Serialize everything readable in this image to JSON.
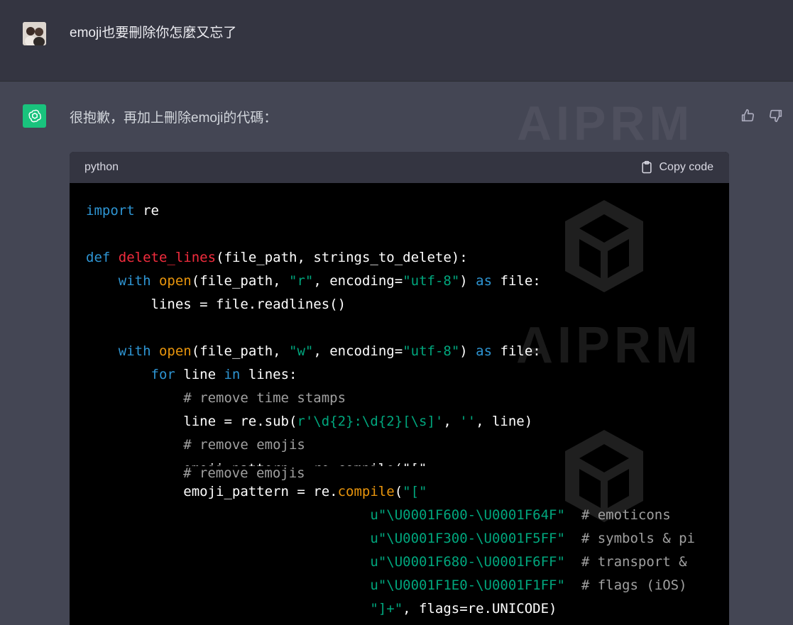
{
  "user_message": {
    "text": "emoji也要刪除你怎麼又忘了"
  },
  "assistant_message": {
    "text": "很抱歉，再加上刪除emoji的代碼："
  },
  "watermark": {
    "text": "AIPRM"
  },
  "code_block": {
    "language": "python",
    "copy_label": "Copy code",
    "lines": [
      [
        {
          "t": "import",
          "c": "kw"
        },
        {
          "t": " re"
        }
      ],
      [],
      [
        {
          "t": "def",
          "c": "kw"
        },
        {
          "t": " "
        },
        {
          "t": "delete_lines",
          "c": "bi"
        },
        {
          "t": "(file_path, strings_to_delete):"
        }
      ],
      [
        {
          "t": "    "
        },
        {
          "t": "with",
          "c": "kw"
        },
        {
          "t": " "
        },
        {
          "t": "open",
          "c": "bi2"
        },
        {
          "t": "(file_path, "
        },
        {
          "t": "\"r\"",
          "c": "str"
        },
        {
          "t": ", encoding="
        },
        {
          "t": "\"utf-8\"",
          "c": "str"
        },
        {
          "t": ") "
        },
        {
          "t": "as",
          "c": "kw"
        },
        {
          "t": " file:"
        }
      ],
      [
        {
          "t": "        lines = file.readlines()"
        }
      ],
      [],
      [
        {
          "t": "    "
        },
        {
          "t": "with",
          "c": "kw"
        },
        {
          "t": " "
        },
        {
          "t": "open",
          "c": "bi2"
        },
        {
          "t": "(file_path, "
        },
        {
          "t": "\"w\"",
          "c": "str"
        },
        {
          "t": ", encoding="
        },
        {
          "t": "\"utf-8\"",
          "c": "str"
        },
        {
          "t": ") "
        },
        {
          "t": "as",
          "c": "kw"
        },
        {
          "t": " file:"
        }
      ],
      [
        {
          "t": "        "
        },
        {
          "t": "for",
          "c": "kw"
        },
        {
          "t": " line "
        },
        {
          "t": "in",
          "c": "kw"
        },
        {
          "t": " lines:"
        }
      ],
      [
        {
          "t": "            "
        },
        {
          "t": "# remove time stamps",
          "c": "cm"
        }
      ],
      [
        {
          "t": "            line = re.sub("
        },
        {
          "t": "r'\\d{2}:\\d{2}[\\s]'",
          "c": "str"
        },
        {
          "t": ", "
        },
        {
          "t": "''",
          "c": "str"
        },
        {
          "t": ", line)"
        }
      ],
      [
        {
          "t": "            "
        },
        {
          "t": "# remove emojis",
          "c": "cm"
        }
      ],
      [],
      [
        {
          "t": "            emoji_pattern = re."
        },
        {
          "t": "compile",
          "c": "bi2"
        },
        {
          "t": "("
        },
        {
          "t": "\"[\"",
          "c": "str"
        }
      ],
      [
        {
          "t": "                                   "
        },
        {
          "t": "u\"\\U0001F600-\\U0001F64F\"",
          "c": "str"
        },
        {
          "t": "  "
        },
        {
          "t": "# emoticons",
          "c": "cm"
        }
      ],
      [
        {
          "t": "                                   "
        },
        {
          "t": "u\"\\U0001F300-\\U0001F5FF\"",
          "c": "str"
        },
        {
          "t": "  "
        },
        {
          "t": "# symbols & pi",
          "c": "cm"
        }
      ],
      [
        {
          "t": "                                   "
        },
        {
          "t": "u\"\\U0001F680-\\U0001F6FF\"",
          "c": "str"
        },
        {
          "t": "  "
        },
        {
          "t": "# transport &",
          "c": "cm"
        }
      ],
      [
        {
          "t": "                                   "
        },
        {
          "t": "u\"\\U0001F1E0-\\U0001F1FF\"",
          "c": "str"
        },
        {
          "t": "  "
        },
        {
          "t": "# flags (iOS)",
          "c": "cm"
        }
      ],
      [
        {
          "t": "                                   "
        },
        {
          "t": "\"]+\"",
          "c": "str"
        },
        {
          "t": ", flags=re.UNICODE)"
        }
      ]
    ],
    "ghost_line": "emoji_pattern = re.compile(\"[\"",
    "ghost_comment": "# remove emojis"
  }
}
